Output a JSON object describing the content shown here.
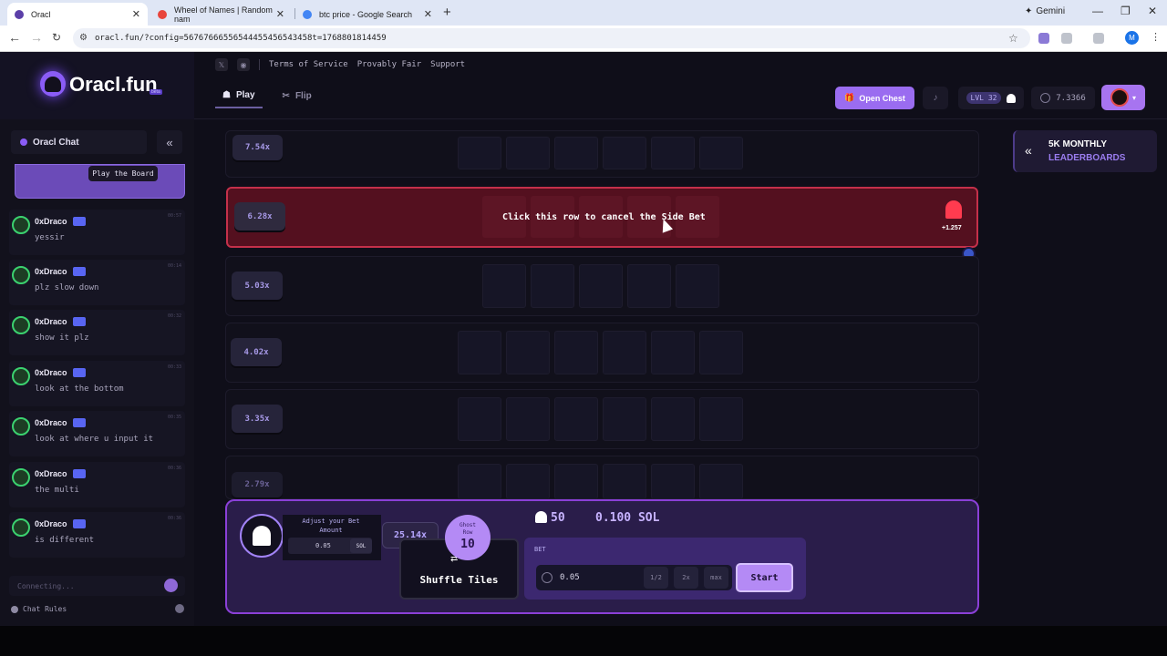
{
  "browser": {
    "tabs": [
      {
        "title": "Oracl",
        "favicon_color": "#5b3fa8"
      },
      {
        "title": "Wheel of Names | Random nam",
        "favicon_color": "#e8453c"
      },
      {
        "title": "btc price - Google Search",
        "favicon_color": "#4285f4"
      }
    ],
    "gemini_label": "Gemini",
    "url": "oracl.fun/?config=56767666556544455456543458t=1768801814459",
    "profile_initial": "M"
  },
  "site": {
    "logo_text": "Oracl.fun",
    "beta_label": "beta",
    "toplinks": [
      "Terms of Service",
      "Provably Fair",
      "Support"
    ],
    "nav_tabs": [
      "Play",
      "Flip"
    ],
    "open_chest_label": "Open Chest",
    "level_label": "LVL 32",
    "balance": "7.3366"
  },
  "chat": {
    "title": "Oracl Chat",
    "promo_button": "Play the Board",
    "messages": [
      {
        "user": "0xDraco",
        "text": "yessir",
        "time": "00:57"
      },
      {
        "user": "0xDraco",
        "text": "plz slow down",
        "time": "00:14"
      },
      {
        "user": "0xDraco",
        "text": "show it plz",
        "time": "00:32"
      },
      {
        "user": "0xDraco",
        "text": "look at the bottom",
        "time": "00:33"
      },
      {
        "user": "0xDraco",
        "text": "look at where u input it",
        "time": "00:35"
      },
      {
        "user": "0xDraco",
        "text": "the multi",
        "time": "00:36"
      },
      {
        "user": "0xDraco",
        "text": "is different",
        "time": "00:36"
      }
    ],
    "input_placeholder": "Connecting...",
    "rules_label": "Chat Rules"
  },
  "board": {
    "rows": [
      {
        "multiplier": "7.54x"
      },
      {
        "multiplier": "6.28x"
      },
      {
        "multiplier": "5.03x"
      },
      {
        "multiplier": "4.02x"
      },
      {
        "multiplier": "3.35x"
      },
      {
        "multiplier": "2.79x"
      }
    ],
    "sidebet_text": "Click this row to cancel the Side Bet",
    "sidebet_value": "+1.257"
  },
  "leaderboard": {
    "line1": "5K MONTHLY",
    "line2": "LEADERBOARDS"
  },
  "controls": {
    "adjust_label": "Adjust your Bet Amount",
    "adjust_value": "0.05",
    "adjust_currency": "SOL",
    "total_multiplier": "25.14x",
    "ghost_row_label": "Ghost Row",
    "ghost_row_value": "10",
    "shuffle_label": "Shuffle Tiles",
    "ghost_count": "50",
    "sol_total": "0.100 SOL",
    "bet_label": "BET",
    "bet_value": "0.05",
    "chips": [
      "1/2",
      "2x",
      "max"
    ],
    "start_label": "Start"
  },
  "colors": {
    "accent": "#9a6cf0",
    "sidebet_border": "#c4304a",
    "panel_border": "#8b40d8",
    "online": "#3bd16f"
  }
}
